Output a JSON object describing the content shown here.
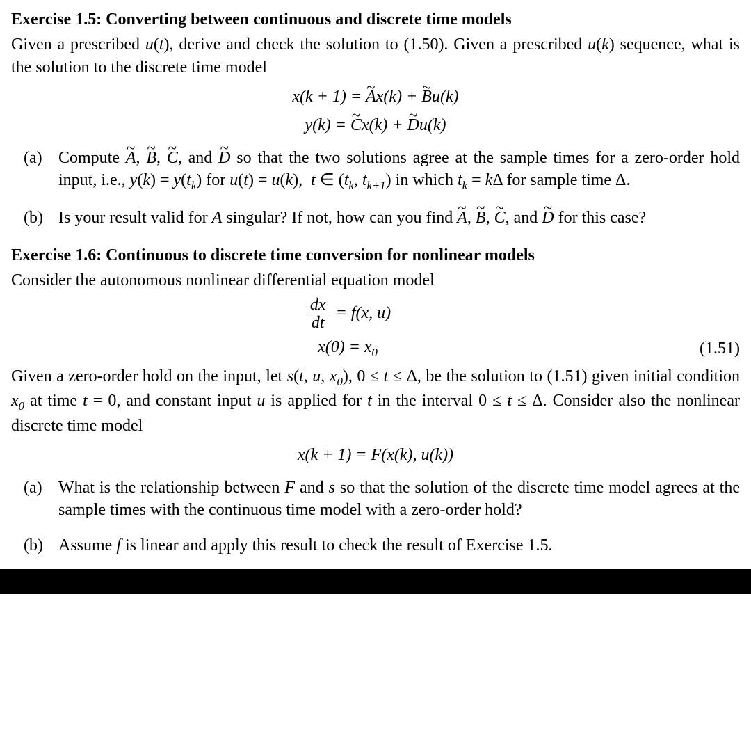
{
  "ex15": {
    "title": "Exercise 1.5: Converting between continuous and discrete time models",
    "intro_1": "Given a prescribed ",
    "intro_2": ", derive and check the solution to (1.50). Given a prescribed ",
    "intro_3": " sequence, what is the solution to the discrete time model",
    "a_marker": "(a)",
    "a_1": "Compute ",
    "a_2": ", and ",
    "a_3": " so that the two solutions agree at the sample times for a zero-order hold input, i.e., ",
    "a_4": " for ",
    "a_5": " in which ",
    "a_6": " for sample time Δ.",
    "b_marker": "(b)",
    "b_1": "Is your result valid for ",
    "b_2": " singular? If not, how can you find ",
    "b_3": ", and ",
    "b_4": " for this case?"
  },
  "ex16": {
    "title": "Exercise 1.6: Continuous to discrete time conversion for nonlinear models",
    "intro": "Consider the autonomous nonlinear differential equation model",
    "eq_num": "(1.51)",
    "after_eq_1": "Given a zero-order hold on the input, let ",
    "after_eq_2": ", be the solution to (1.51) given initial condition ",
    "after_eq_3": " at time ",
    "after_eq_4": ", and constant input ",
    "after_eq_5": " is applied for ",
    "after_eq_6": " in the interval ",
    "after_eq_7": ". Consider also the nonlinear discrete time model",
    "a_marker": "(a)",
    "a_1": "What is the relationship between ",
    "a_2": " and ",
    "a_3": " so that the solution of the discrete time model agrees at the sample times with the continuous time model with a zero-order hold?",
    "b_marker": "(b)",
    "b_1": "Assume ",
    "b_2": " is linear and apply this result to check the result of Exercise 1.5."
  }
}
